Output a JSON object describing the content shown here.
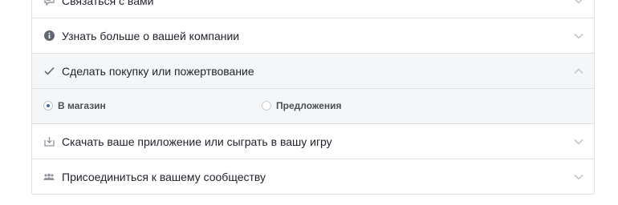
{
  "items": [
    {
      "label": "Связаться с вами",
      "icon": "chat-bubble-icon",
      "expanded": false
    },
    {
      "label": "Узнать больше о вашей компании",
      "icon": "info-icon",
      "expanded": false
    },
    {
      "label": "Сделать покупку или пожертвование",
      "icon": "checkmark-icon",
      "expanded": true
    },
    {
      "label": "Скачать ваше приложение или сыграть в вашу игру",
      "icon": "download-icon",
      "expanded": false
    },
    {
      "label": "Присоединиться к вашему сообществу",
      "icon": "people-icon",
      "expanded": false
    }
  ],
  "purchase_options": {
    "option1": {
      "label": "В магазин",
      "selected": true
    },
    "option2": {
      "label": "Предложения",
      "selected": false
    }
  },
  "colors": {
    "accent": "#4267b2",
    "border": "#dddfe2",
    "expanded_bg": "#f5f6f7",
    "icon_gray": "#90949c"
  }
}
